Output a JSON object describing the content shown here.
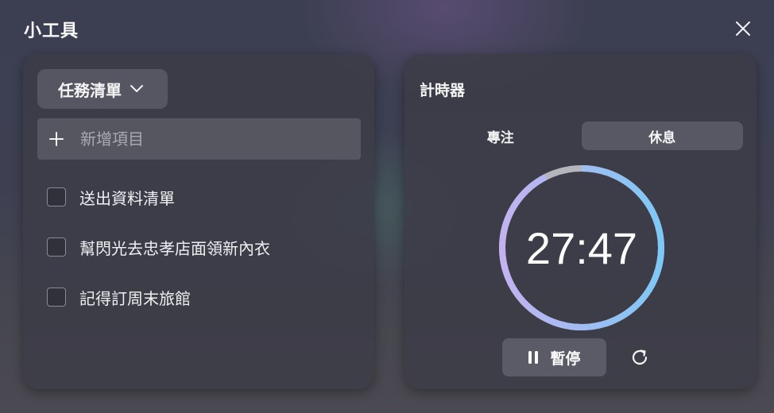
{
  "window": {
    "title": "小工具",
    "close_icon": "close-icon"
  },
  "tasks": {
    "list_selector": {
      "label": "任務清單",
      "icon": "chevron-down-icon"
    },
    "add_item": {
      "icon": "plus-icon",
      "placeholder": "新增項目",
      "value": ""
    },
    "items": [
      {
        "label": "送出資料清單",
        "checked": false
      },
      {
        "label": "幫閃光去忠孝店面領新內衣",
        "checked": false
      },
      {
        "label": "記得訂周末旅館",
        "checked": false
      }
    ]
  },
  "timer": {
    "title": "計時器",
    "tabs": [
      {
        "label": "專注",
        "active": true
      },
      {
        "label": "休息",
        "active": false
      }
    ],
    "time": "27:47",
    "progress_fraction": 0.925,
    "ring_colors": {
      "start": "#c3b2f0",
      "end": "#7ec8f6",
      "track": "#b5b5bd"
    },
    "pause": {
      "label": "暫停",
      "icon": "pause-icon"
    },
    "reset_icon": "reset-icon"
  }
}
